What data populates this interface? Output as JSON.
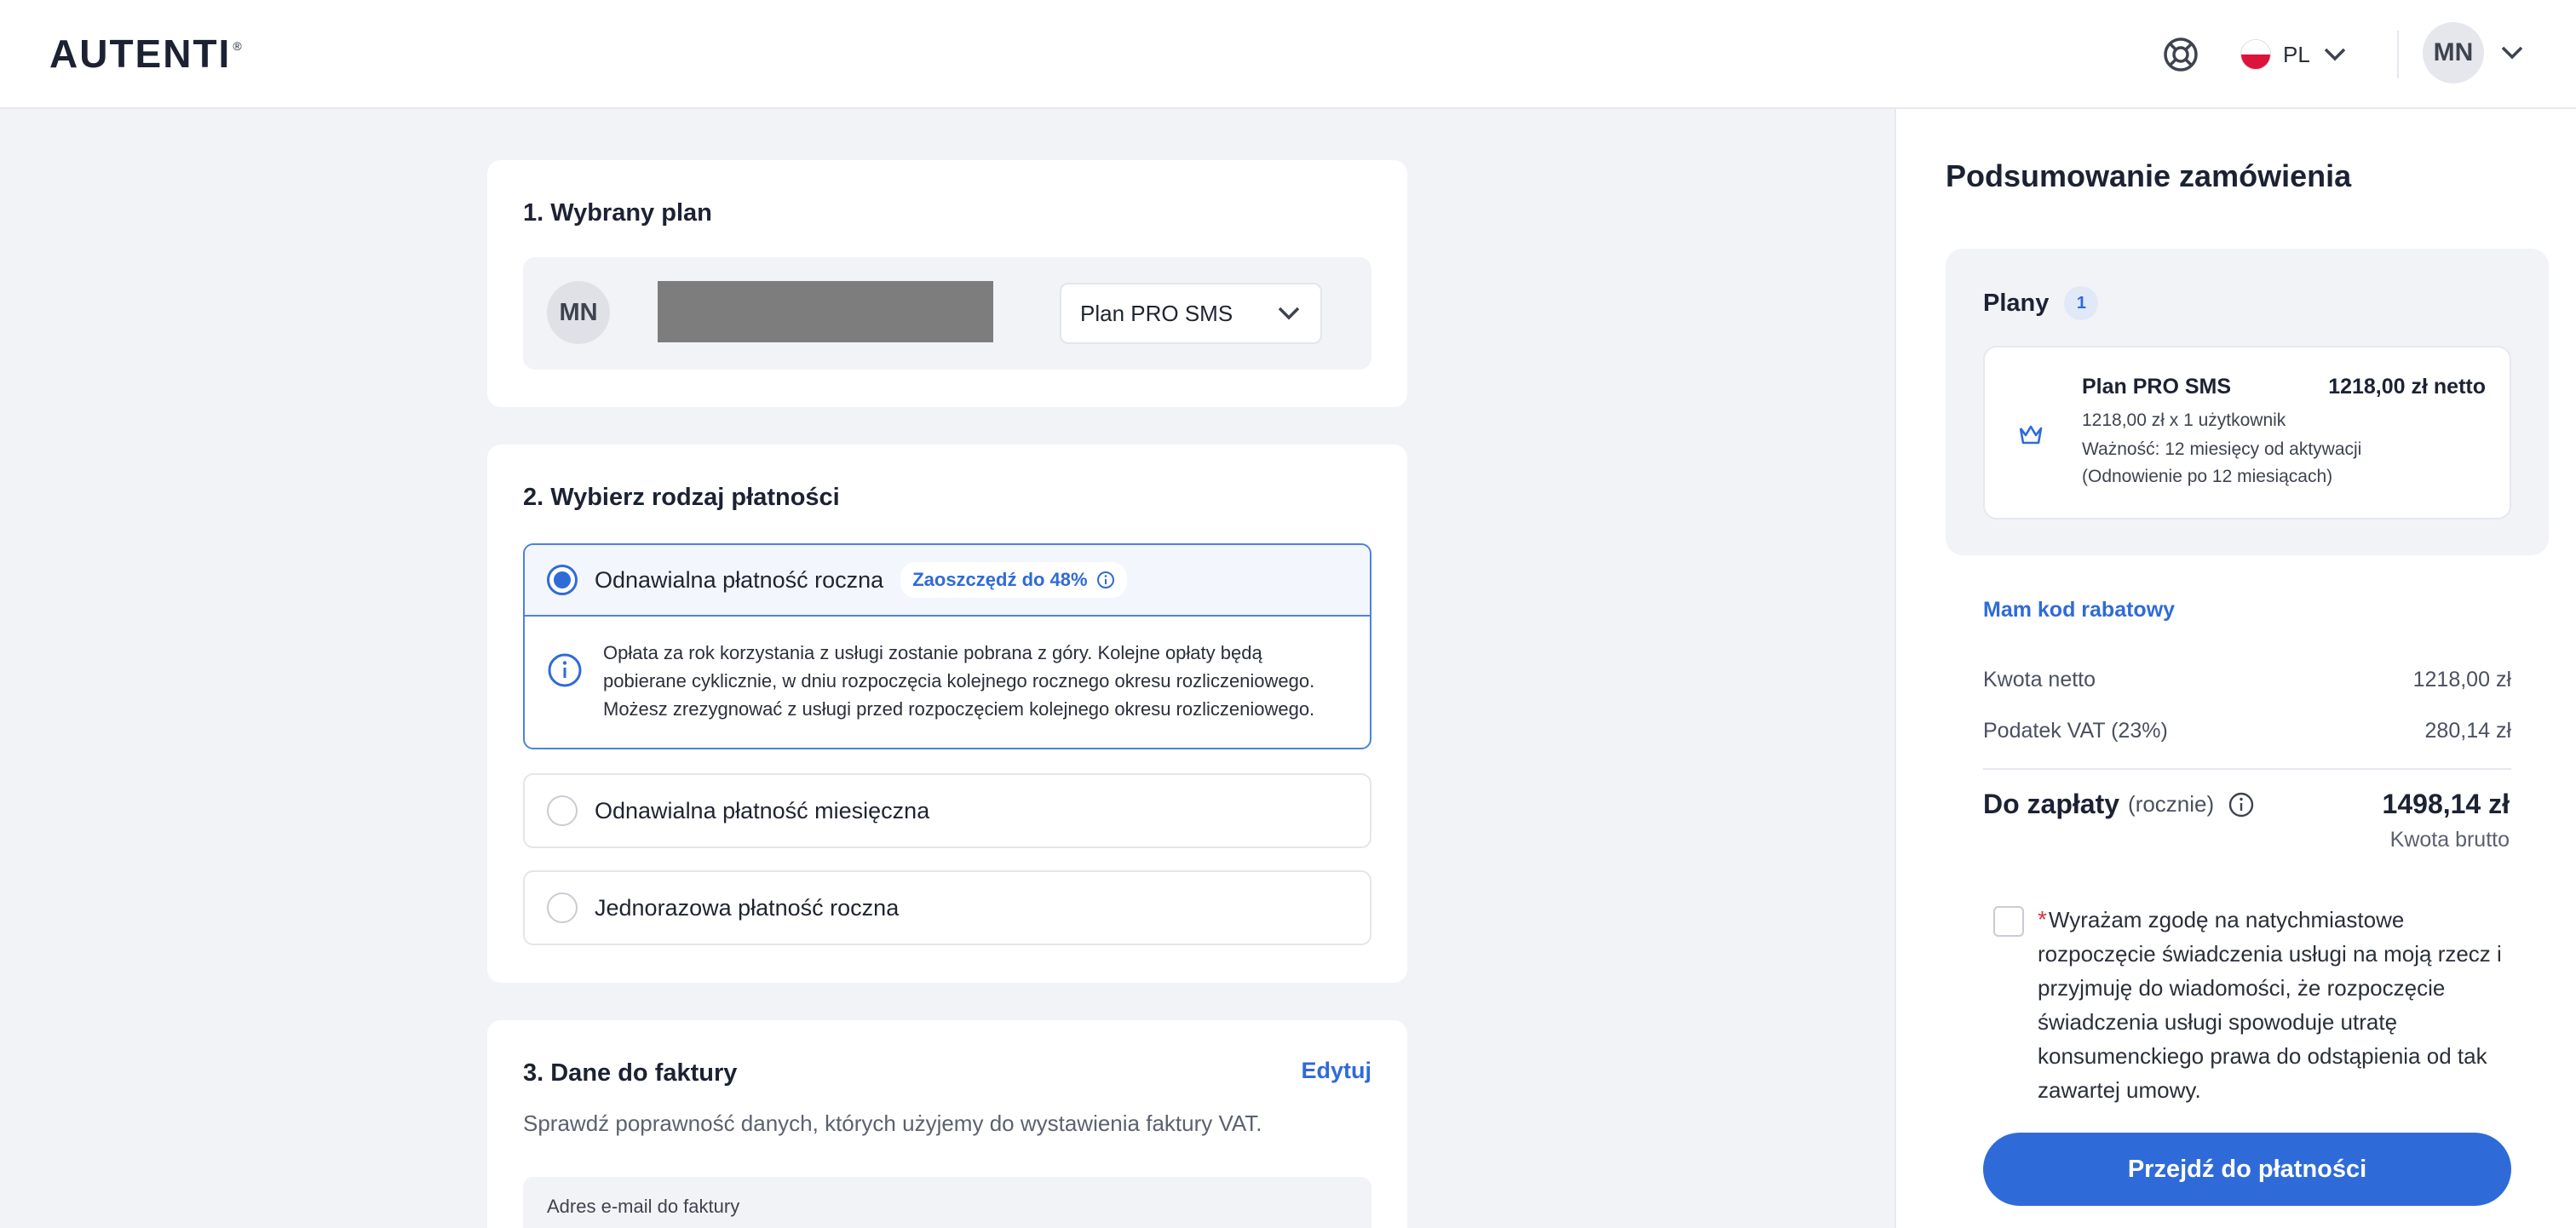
{
  "header": {
    "logo_text": "AUTENTI",
    "logo_reg": "®",
    "lang": "PL",
    "user_initials": "MN"
  },
  "section1": {
    "title": "1. Wybrany plan",
    "avatar_initials": "MN",
    "plan_select_value": "Plan PRO SMS"
  },
  "section2": {
    "title": "2. Wybierz rodzaj płatności",
    "options": [
      {
        "label": "Odnawialna płatność roczna",
        "badge": "Zaoszczędź do 48%",
        "selected": true,
        "description": [
          "Opłata za rok korzystania z usługi zostanie pobrana z góry. Kolejne opłaty będą",
          "pobierane cyklicznie, w dniu rozpoczęcia kolejnego rocznego okresu rozliczeniowego.",
          "Możesz zrezygnować z usługi przed rozpoczęciem kolejnego okresu rozliczeniowego."
        ]
      },
      {
        "label": "Odnawialna płatność miesięczna",
        "selected": false
      },
      {
        "label": "Jednorazowa płatność roczna",
        "selected": false
      }
    ]
  },
  "section3": {
    "title": "3. Dane do faktury",
    "edit": "Edytuj",
    "subtitle": "Sprawdź poprawność danych, których użyjemy do wystawienia faktury VAT.",
    "email_label": "Adres e-mail do faktury"
  },
  "summary": {
    "title": "Podsumowanie zamówienia",
    "plans_title": "Plany",
    "plans_count": "1",
    "plan": {
      "name": "Plan PRO SMS",
      "price": "1218,00 zł netto",
      "line1": "1218,00 zł x 1 użytkownik",
      "line2": "Ważność: 12 miesięcy od aktywacji",
      "line3": "(Odnowienie po 12 miesiącach)"
    },
    "discount_link": "Mam kod rabatowy",
    "net_label": "Kwota netto",
    "net_value": "1218,00 zł",
    "vat_label": "Podatek VAT (23%)",
    "vat_value": "280,14 zł",
    "total_label": "Do zapłaty",
    "total_period": "(rocznie)",
    "total_value": "1498,14 zł",
    "gross_label": "Kwota brutto",
    "consent_required_mark": "*",
    "consent_text": "Wyrażam zgodę na natychmiastowe rozpoczęcie świadczenia usługi na moją rzecz i przyjmuję do wiadomości, że rozpoczęcie świadczenia usługi spowoduje utratę konsumenckiego prawa do odstąpienia od tak zawartej umowy.",
    "pay_button": "Przejdź do płatności"
  },
  "colors": {
    "accent": "#2f6bd8",
    "background": "#f1f3f7",
    "required": "#e0303c"
  }
}
